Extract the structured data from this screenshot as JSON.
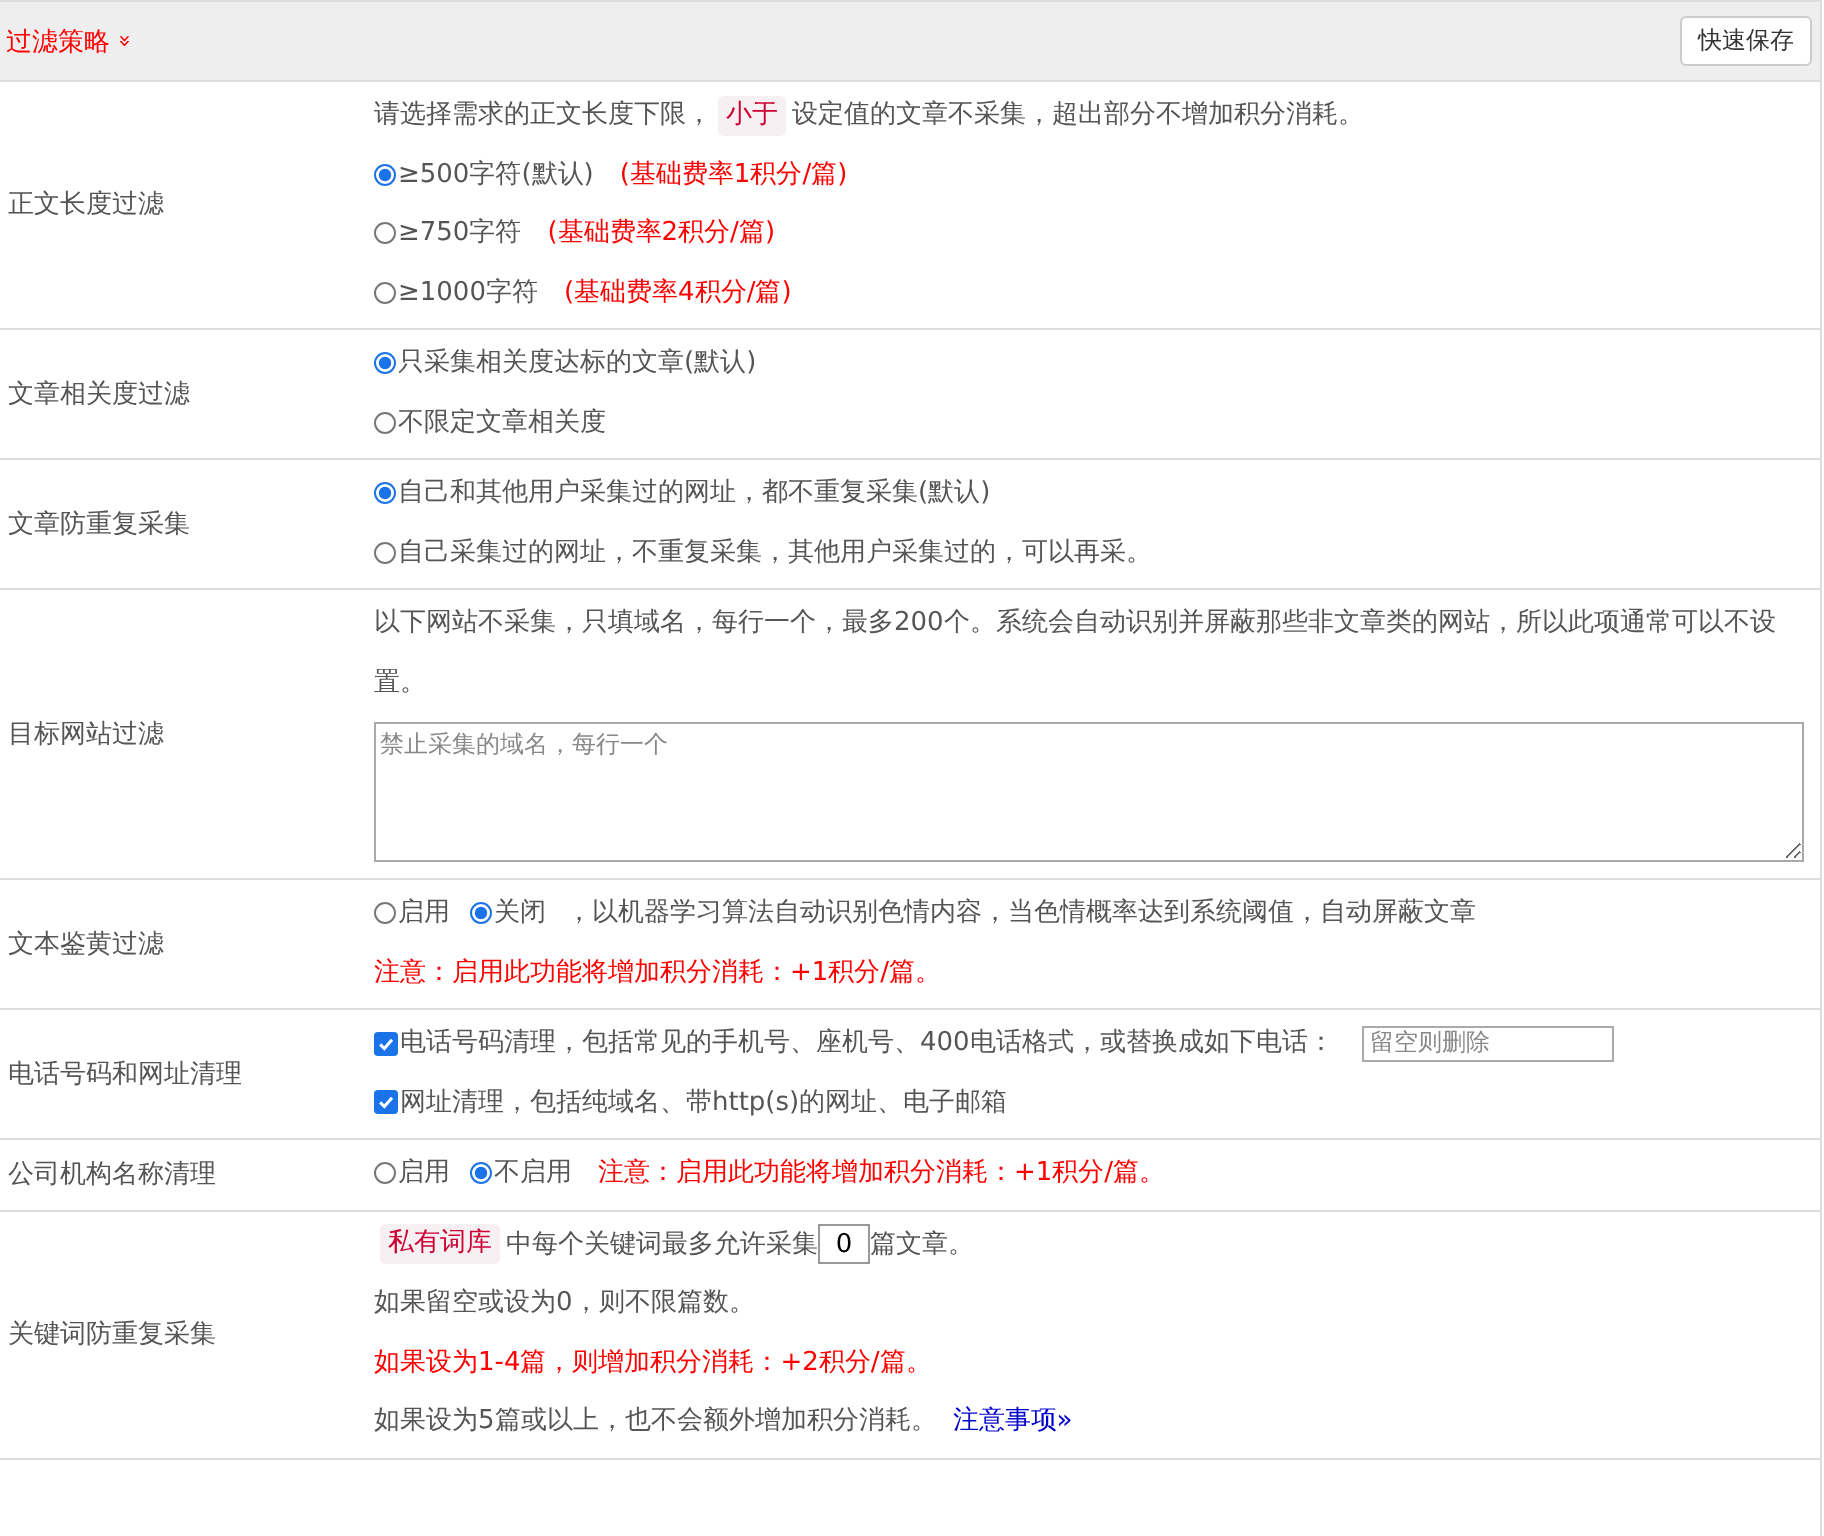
{
  "header": {
    "title": "过滤策略",
    "expand_icon": "»",
    "save_button": "快速保存"
  },
  "rows": [
    {
      "label": "正文长度过滤",
      "lines": [
        [
          {
            "kind": "text",
            "text": "请选择需求的正文长度下限，"
          },
          {
            "kind": "tag",
            "text": "小于"
          },
          {
            "kind": "text",
            "text": "设定值的文章不采集，超出部分不增加积分消耗。"
          }
        ],
        [
          {
            "kind": "radio",
            "label": "≥500字符(默认)",
            "selected": true
          },
          {
            "kind": "text",
            "red": true,
            "text": "(基础费率1积分/篇)"
          }
        ],
        [
          {
            "kind": "radio",
            "label": "≥750字符",
            "selected": false
          },
          {
            "kind": "text",
            "red": true,
            "text": "(基础费率2积分/篇)"
          }
        ],
        [
          {
            "kind": "radio",
            "label": "≥1000字符",
            "selected": false
          },
          {
            "kind": "text",
            "red": true,
            "text": "(基础费率4积分/篇)"
          }
        ]
      ]
    },
    {
      "label": "文章相关度过滤",
      "lines": [
        [
          {
            "kind": "radio",
            "label": "只采集相关度达标的文章(默认)",
            "selected": true
          }
        ],
        [
          {
            "kind": "radio",
            "label": "不限定文章相关度",
            "selected": false
          }
        ]
      ]
    },
    {
      "label": "文章防重复采集",
      "lines": [
        [
          {
            "kind": "radio",
            "label": "自己和其他用户采集过的网址，都不重复采集(默认)",
            "selected": true
          }
        ],
        [
          {
            "kind": "radio",
            "label": "自己采集过的网址，不重复采集，其他用户采集过的，可以再采。",
            "selected": false
          }
        ]
      ]
    },
    {
      "label": "目标网站过滤",
      "lines": [
        [
          {
            "kind": "text",
            "text": "以下网站不采集，只填域名，每行一个，最多200个。系统会自动识别并屏蔽那些非文章类的网站，所以此项通常可以不设置。"
          }
        ],
        [
          {
            "kind": "textarea",
            "placeholder": "禁止采集的域名，每行一个"
          }
        ]
      ]
    },
    {
      "label": "文本鉴黄过滤",
      "lines": [
        [
          {
            "kind": "radio",
            "label": "启用",
            "selected": false
          },
          {
            "kind": "radio",
            "label": "关闭",
            "selected": true
          },
          {
            "kind": "text",
            "text": "，以机器学习算法自动识别色情内容，当色情概率达到系统阈值，自动屏蔽文章"
          }
        ],
        [
          {
            "kind": "text",
            "red": true,
            "text": "注意：启用此功能将增加积分消耗：+1积分/篇。"
          }
        ]
      ]
    },
    {
      "label": "电话号码和网址清理",
      "lines": [
        [
          {
            "kind": "checkbox",
            "label": "电话号码清理，包括常见的手机号、座机号、400电话格式，或替换成如下电话：",
            "checked": true
          },
          {
            "kind": "input",
            "placeholder": "留空则删除"
          }
        ],
        [
          {
            "kind": "checkbox",
            "label": "网址清理，包括纯域名、带http(s)的网址、电子邮箱",
            "checked": true
          }
        ]
      ]
    },
    {
      "label": "公司机构名称清理",
      "lines": [
        [
          {
            "kind": "radio",
            "label": "启用",
            "selected": false
          },
          {
            "kind": "radio",
            "label": "不启用",
            "selected": true
          },
          {
            "kind": "text",
            "red": true,
            "text": "注意：启用此功能将增加积分消耗：+1积分/篇。"
          }
        ]
      ]
    },
    {
      "label": "关键词防重复采集",
      "lines": [
        [
          {
            "kind": "tag",
            "text": "私有词库"
          },
          {
            "kind": "text",
            "text": "中每个关键词最多允许采集"
          },
          {
            "kind": "number",
            "value": "0"
          },
          {
            "kind": "text",
            "text": "篇文章。"
          }
        ],
        [
          {
            "kind": "text",
            "text": "如果留空或设为0，则不限篇数。"
          }
        ],
        [
          {
            "kind": "text",
            "red": true,
            "text": "如果设为1-4篇，则增加积分消耗：+2积分/篇。"
          }
        ],
        [
          {
            "kind": "text",
            "text": "如果设为5篇或以上，也不会额外增加积分消耗。"
          },
          {
            "kind": "link",
            "text": "注意事项",
            "icon": "»"
          }
        ]
      ]
    }
  ]
}
